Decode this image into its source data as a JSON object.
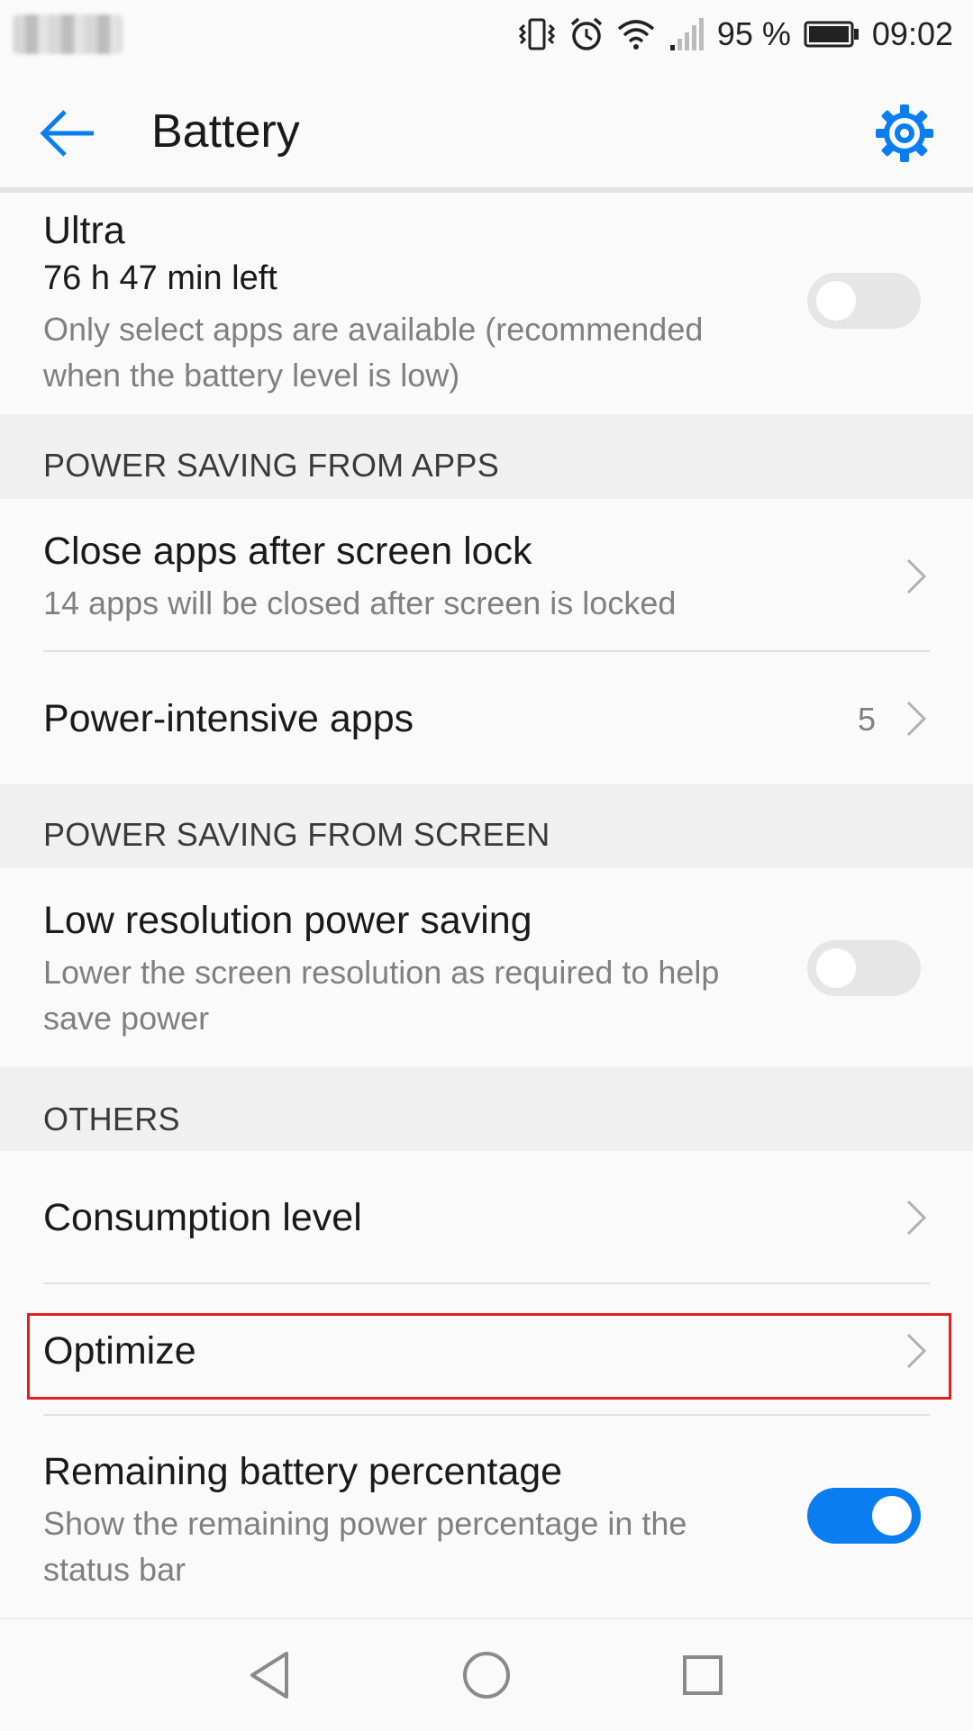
{
  "status_bar": {
    "battery_percent": "95 %",
    "time": "09:02",
    "icons": [
      "vibrate-icon",
      "alarm-icon",
      "wifi-icon",
      "signal-icon",
      "battery-icon"
    ]
  },
  "app_bar": {
    "title": "Battery",
    "back_icon": "arrow-left-icon",
    "settings_icon": "gear-icon",
    "accent_color": "#0a7ef0"
  },
  "ultra": {
    "title": "Ultra",
    "time_left": "76 h 47 min left",
    "description_line1": "Only select apps are available (recommended",
    "description_line2": "when the battery level is low)",
    "enabled": false
  },
  "sections": {
    "apps_header": "POWER SAVING FROM APPS",
    "screen_header": "POWER SAVING FROM SCREEN",
    "others_header": "OTHERS"
  },
  "close_apps": {
    "title": "Close apps after screen lock",
    "subtitle": "14 apps will be closed after screen is locked"
  },
  "power_intensive": {
    "title": "Power-intensive apps",
    "count": "5"
  },
  "low_res": {
    "title": "Low resolution power saving",
    "description_line1": "Lower the screen resolution as required to help",
    "description_line2": "save power",
    "enabled": false
  },
  "consumption": {
    "title": "Consumption level"
  },
  "optimize": {
    "title": "Optimize",
    "highlight_color": "#e02020"
  },
  "remaining": {
    "title": "Remaining battery percentage",
    "description_line1": "Show the remaining power percentage in the",
    "description_line2": "status bar",
    "enabled": true
  },
  "nav": {
    "icons": [
      "nav-back-icon",
      "nav-home-icon",
      "nav-recents-icon"
    ]
  }
}
